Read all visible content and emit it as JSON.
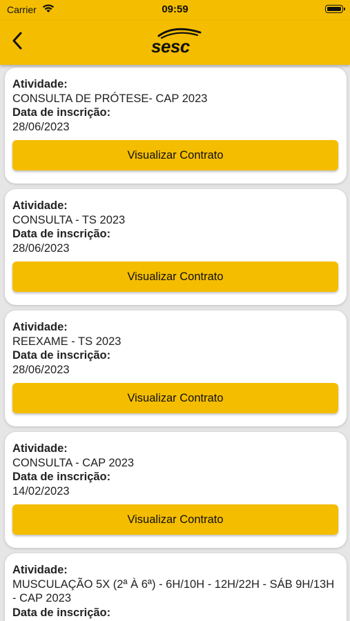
{
  "status_bar": {
    "carrier": "Carrier",
    "time": "09:59"
  },
  "header": {
    "logo_text": "Sesc",
    "accent_color": "#f4bd00"
  },
  "labels": {
    "activity": "Atividade:",
    "registration_date": "Data de inscrição:"
  },
  "cards": [
    {
      "activity": "CONSULTA DE PRÓTESE- CAP 2023",
      "date": "28/06/2023",
      "button": "Visualizar Contrato"
    },
    {
      "activity": "CONSULTA - TS 2023",
      "date": "28/06/2023",
      "button": "Visualizar Contrato"
    },
    {
      "activity": "REEXAME - TS 2023",
      "date": "28/06/2023",
      "button": "Visualizar Contrato"
    },
    {
      "activity": "CONSULTA - CAP 2023",
      "date": "14/02/2023",
      "button": "Visualizar Contrato"
    },
    {
      "activity": "MUSCULAÇÃO 5X (2ª À 6ª) - 6H/10H - 12H/22H - SÁB 9H/13H - CAP 2023",
      "date": "",
      "button": ""
    }
  ]
}
